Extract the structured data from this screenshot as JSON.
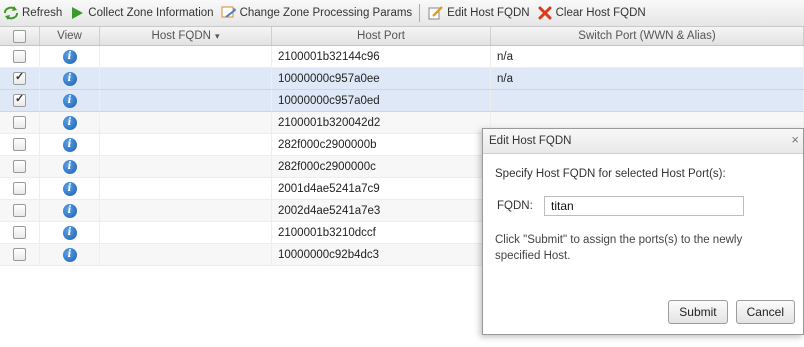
{
  "toolbar": {
    "refresh_label": "Refresh",
    "collect_label": "Collect Zone Information",
    "change_label": "Change Zone Processing Params",
    "edit_label": "Edit Host FQDN",
    "clear_label": "Clear Host FQDN",
    "icons": [
      "refresh-icon",
      "play-icon",
      "change-params-icon",
      "edit-icon",
      "clear-x-icon"
    ]
  },
  "table": {
    "columns": [
      "View",
      "Host FQDN",
      "Host Port",
      "Switch Port (WWN & Alias)"
    ],
    "sort_indicator": "▾",
    "rows": [
      {
        "checked": false,
        "host_fqdn": "",
        "host_port": "2100001b32144c96",
        "switch_port": "n/a"
      },
      {
        "checked": true,
        "host_fqdn": "",
        "host_port": "10000000c957a0ee",
        "switch_port": "n/a"
      },
      {
        "checked": true,
        "host_fqdn": "",
        "host_port": "10000000c957a0ed",
        "switch_port": ""
      },
      {
        "checked": false,
        "host_fqdn": "",
        "host_port": "2100001b320042d2",
        "switch_port": ""
      },
      {
        "checked": false,
        "host_fqdn": "",
        "host_port": "282f000c2900000b",
        "switch_port": ""
      },
      {
        "checked": false,
        "host_fqdn": "",
        "host_port": "282f000c2900000c",
        "switch_port": ""
      },
      {
        "checked": false,
        "host_fqdn": "",
        "host_port": "2001d4ae5241a7c9",
        "switch_port": ""
      },
      {
        "checked": false,
        "host_fqdn": "",
        "host_port": "2002d4ae5241a7e3",
        "switch_port": ""
      },
      {
        "checked": false,
        "host_fqdn": "",
        "host_port": "2100001b3210dccf",
        "switch_port": ""
      },
      {
        "checked": false,
        "host_fqdn": "",
        "host_port": "10000000c92b4dc3",
        "switch_port": ""
      }
    ]
  },
  "dialog": {
    "title": "Edit Host FQDN",
    "close": "×",
    "instruction": "Specify Host FQDN for selected Host Port(s):",
    "fqdn_label": "FQDN:",
    "fqdn_value": "titan",
    "note": "Click \"Submit\" to assign the ports(s) to the newly specified Host.",
    "submit_label": "Submit",
    "cancel_label": "Cancel"
  },
  "colors": {
    "selected_row": "#dfe8f6",
    "info_icon": "#1a5fb4",
    "clear_icon": "#d93a1b",
    "play_icon": "#3c9a2a"
  }
}
